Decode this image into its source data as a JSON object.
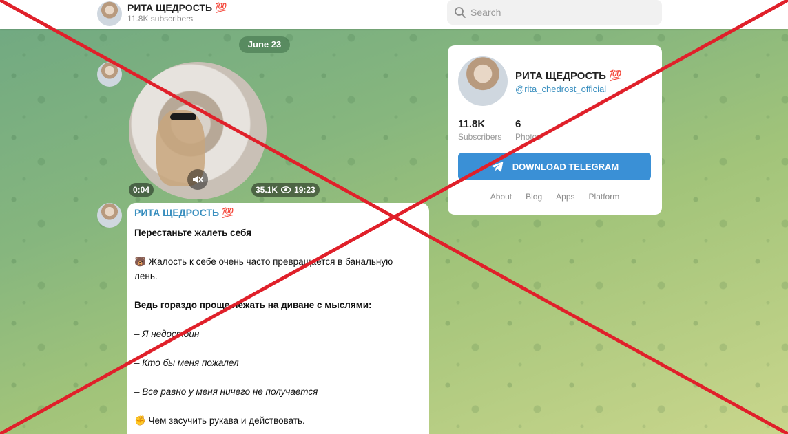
{
  "header": {
    "channel_title": "РИТА ЩЕДРОСТЬ 💯",
    "subscribers_text": "11.8K subscribers",
    "search_placeholder": "Search"
  },
  "feed": {
    "date_label": "June 23",
    "video": {
      "duration": "0:04",
      "views": "35.1K",
      "time": "19:23"
    },
    "post": {
      "author": "РИТА ЩЕДРОСТЬ 💯",
      "lines": [
        "Перестаньте жалеть себя",
        "🐻 Жалость к себе очень часто превращается в банальную",
        "лень.",
        "Ведь гораздо проще лежать на диване с мыслями:",
        "– Я недостоин",
        "– Кто бы меня пожалел",
        "– Все равно у меня ничего не получается",
        "✊ Чем засучить рукава и действовать."
      ]
    }
  },
  "card": {
    "title": "РИТА ЩЕДРОСТЬ 💯",
    "handle": "@rita_chedrost_official",
    "subscribers_count": "11.8K",
    "subscribers_label": "Subscribers",
    "photos_count": "6",
    "photos_label": "Photos",
    "download_label": "DOWNLOAD TELEGRAM",
    "links": [
      "About",
      "Blog",
      "Apps",
      "Platform"
    ]
  },
  "colors": {
    "accent": "#3a90d6",
    "link": "#3a8fbf",
    "overlay_cross": "#e0202a"
  }
}
